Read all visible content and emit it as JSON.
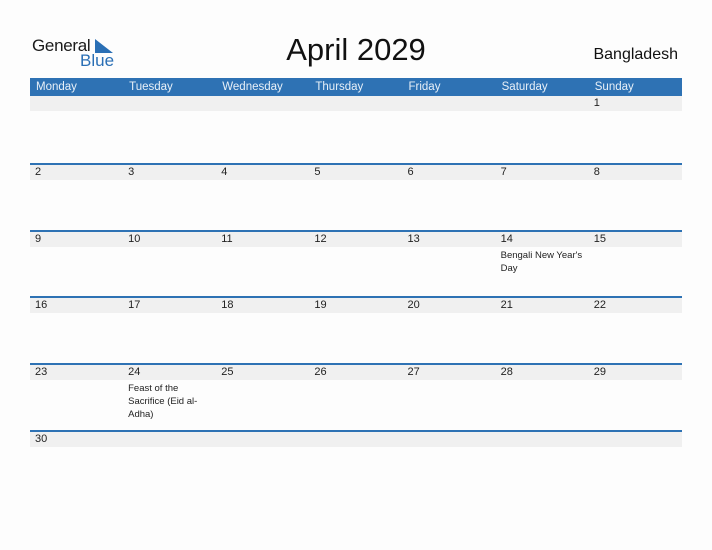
{
  "brand": {
    "line1": "General",
    "line2": "Blue",
    "accent": "#2a6fb5"
  },
  "title": "April 2029",
  "country": "Bangladesh",
  "weekdays": [
    "Monday",
    "Tuesday",
    "Wednesday",
    "Thursday",
    "Friday",
    "Saturday",
    "Sunday"
  ],
  "weeks": [
    {
      "days": [
        {
          "num": "",
          "event": ""
        },
        {
          "num": "",
          "event": ""
        },
        {
          "num": "",
          "event": ""
        },
        {
          "num": "",
          "event": ""
        },
        {
          "num": "",
          "event": ""
        },
        {
          "num": "",
          "event": ""
        },
        {
          "num": "1",
          "event": ""
        }
      ]
    },
    {
      "days": [
        {
          "num": "2",
          "event": ""
        },
        {
          "num": "3",
          "event": ""
        },
        {
          "num": "4",
          "event": ""
        },
        {
          "num": "5",
          "event": ""
        },
        {
          "num": "6",
          "event": ""
        },
        {
          "num": "7",
          "event": ""
        },
        {
          "num": "8",
          "event": ""
        }
      ]
    },
    {
      "days": [
        {
          "num": "9",
          "event": ""
        },
        {
          "num": "10",
          "event": ""
        },
        {
          "num": "11",
          "event": ""
        },
        {
          "num": "12",
          "event": ""
        },
        {
          "num": "13",
          "event": ""
        },
        {
          "num": "14",
          "event": "Bengali New Year's Day"
        },
        {
          "num": "15",
          "event": ""
        }
      ]
    },
    {
      "days": [
        {
          "num": "16",
          "event": ""
        },
        {
          "num": "17",
          "event": ""
        },
        {
          "num": "18",
          "event": ""
        },
        {
          "num": "19",
          "event": ""
        },
        {
          "num": "20",
          "event": ""
        },
        {
          "num": "21",
          "event": ""
        },
        {
          "num": "22",
          "event": ""
        }
      ]
    },
    {
      "days": [
        {
          "num": "23",
          "event": ""
        },
        {
          "num": "24",
          "event": "Feast of the Sacrifice (Eid al-Adha)"
        },
        {
          "num": "25",
          "event": ""
        },
        {
          "num": "26",
          "event": ""
        },
        {
          "num": "27",
          "event": ""
        },
        {
          "num": "28",
          "event": ""
        },
        {
          "num": "29",
          "event": ""
        }
      ]
    },
    {
      "days": [
        {
          "num": "30",
          "event": ""
        },
        {
          "num": "",
          "event": ""
        },
        {
          "num": "",
          "event": ""
        },
        {
          "num": "",
          "event": ""
        },
        {
          "num": "",
          "event": ""
        },
        {
          "num": "",
          "event": ""
        },
        {
          "num": "",
          "event": ""
        }
      ]
    }
  ]
}
